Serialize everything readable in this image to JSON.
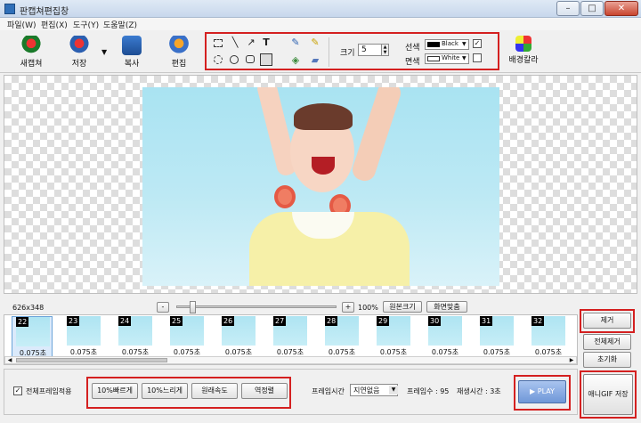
{
  "window": {
    "title": "판캡쳐편집창",
    "minimize_icon": "minimize-icon",
    "maximize_icon": "maximize-icon",
    "close_icon": "close-icon"
  },
  "menu": [
    "파일(W)",
    "편집(X)",
    "도구(Y)",
    "도움말(Z)"
  ],
  "toolbar": {
    "new_capture": "새캡쳐",
    "save": "저장",
    "copy": "복사",
    "edit": "편집",
    "size_label": "크기",
    "size_value": "5",
    "line_color_label": "선색",
    "line_color_value": "Black",
    "fill_color_label": "면색",
    "fill_color_value": "White",
    "bg_color": "배경칼라"
  },
  "canvas": {
    "dimensions": "626x348"
  },
  "zoom": {
    "minus": "-",
    "plus": "+",
    "percent": "100%",
    "original_size": "원본크기",
    "fit_screen": "화면맞춤"
  },
  "frames": [
    {
      "num": "22",
      "dur": "0.075초"
    },
    {
      "num": "23",
      "dur": "0.075초"
    },
    {
      "num": "24",
      "dur": "0.075초"
    },
    {
      "num": "25",
      "dur": "0.075초"
    },
    {
      "num": "26",
      "dur": "0.075초"
    },
    {
      "num": "27",
      "dur": "0.075초"
    },
    {
      "num": "28",
      "dur": "0.075초"
    },
    {
      "num": "29",
      "dur": "0.075초"
    },
    {
      "num": "30",
      "dur": "0.075초"
    },
    {
      "num": "31",
      "dur": "0.075초"
    },
    {
      "num": "32",
      "dur": "0.075초"
    }
  ],
  "side": {
    "remove": "제거",
    "remove_all": "전체제거",
    "reset": "초기화",
    "save_gif": "애니GIF 저장"
  },
  "bottom": {
    "apply_all": "전체프레임적용",
    "faster": "10%빠르게",
    "slower": "10%느리게",
    "original_speed": "원래속도",
    "reverse": "역정렬",
    "frame_time_label": "프레임시간",
    "frame_time_value": "지연없음",
    "frame_count": "프레임수 : 95",
    "play_time": "재생시간 : 3초",
    "play": "▶ PLAY"
  }
}
